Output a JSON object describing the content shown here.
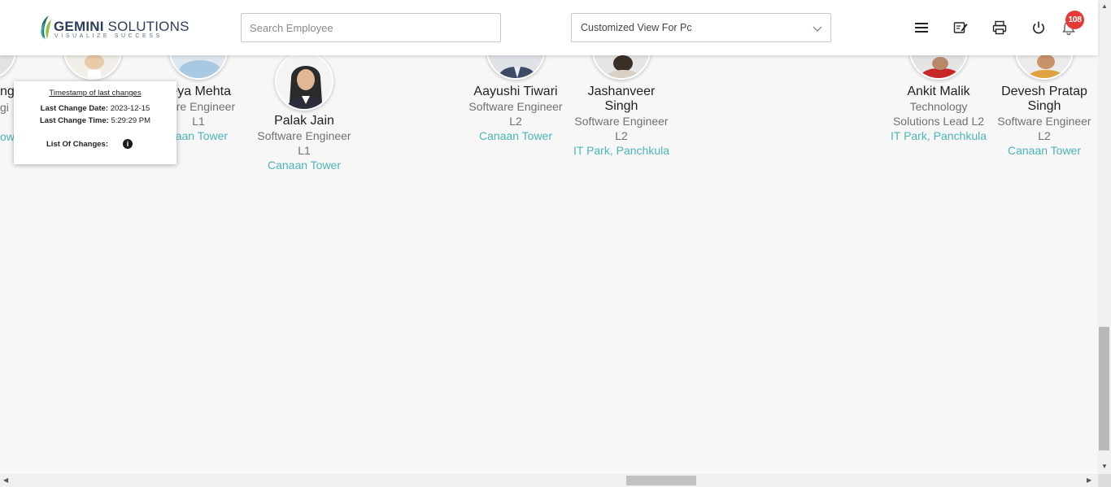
{
  "header": {
    "logo_name_bold": "GEMINI",
    "logo_name_rest": " SOLUTIONS",
    "logo_tagline": "VISUALIZE SUCCESS",
    "search_placeholder": "Search Employee",
    "view_select_value": "Customized View For Pc",
    "notification_count": "108",
    "icons": [
      "menu-icon",
      "edit-note-icon",
      "print-icon",
      "power-icon",
      "bell-icon"
    ]
  },
  "employees": [
    {
      "name": "",
      "role_lines": [
        "",
        "",
        ""
      ],
      "location": ""
    },
    {
      "name": "",
      "role_lines": [],
      "location": ""
    },
    {
      "name": "reya Mehta",
      "role_lines": [
        "ware Engineer",
        "L1"
      ],
      "location": "naan Tower"
    },
    {
      "name": "Palak Jain",
      "role_lines": [
        "Software Engineer",
        "L1"
      ],
      "location": "Canaan Tower"
    },
    {
      "name": "Aayushi Tiwari",
      "role_lines": [
        "Software Engineer",
        "L2"
      ],
      "location": "Canaan Tower"
    },
    {
      "name_lines": [
        "Jashanveer",
        "Singh"
      ],
      "role_lines": [
        "Software Engineer",
        "L2"
      ],
      "location": "IT Park, Panchkula"
    },
    {
      "name": "Ankit Malik",
      "role_lines": [
        "Technology",
        "Solutions Lead L2"
      ],
      "location": "IT Park, Panchkula"
    },
    {
      "name_lines": [
        "Devesh Pratap",
        "Singh"
      ],
      "role_lines": [
        "Software Engineer",
        "L2"
      ],
      "location": "Canaan Tower"
    }
  ],
  "partial_left": {
    "name": "ng",
    "role": "gi",
    "location": "ow"
  },
  "tooltip": {
    "title": "Timestamp of last changes",
    "date_label": "Last Change Date:",
    "date_value": "2023-12-15",
    "time_label": "Last Change Time:",
    "time_value": "5:29:29 PM",
    "changes_label": "List Of Changes:",
    "info_glyph": "i"
  },
  "colors": {
    "accent_location": "#4bb5b8",
    "badge": "#e53935",
    "logo_text": "#2b3e5c",
    "logo_leaf_dark": "#1f6b5e",
    "logo_leaf_light": "#8bc34a"
  }
}
